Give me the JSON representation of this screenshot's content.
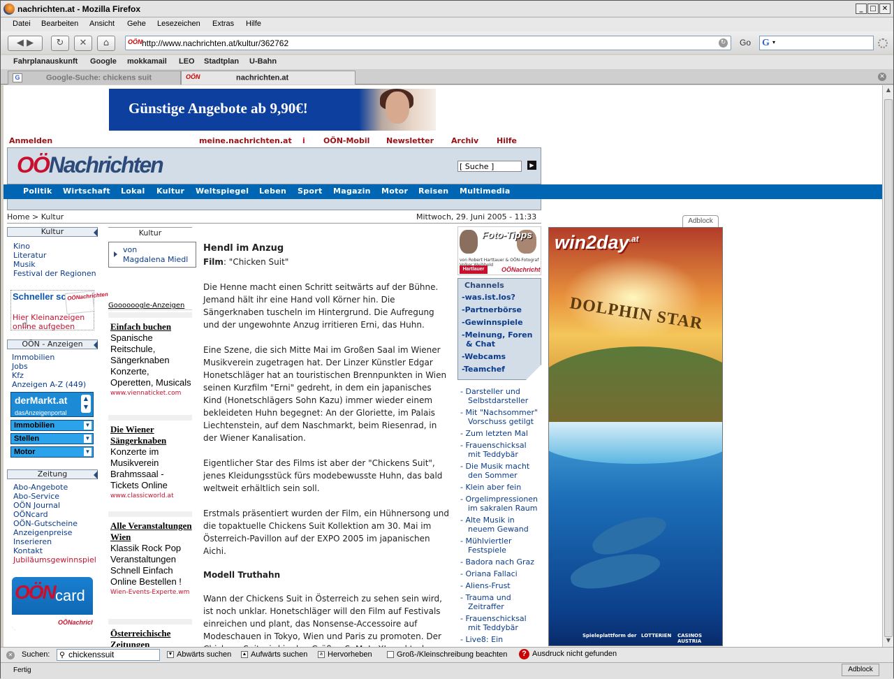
{
  "window": {
    "title": "nachrichten.at - Mozilla Firefox"
  },
  "menu": [
    "Datei",
    "Bearbeiten",
    "Ansicht",
    "Gehe",
    "Lesezeichen",
    "Extras",
    "Hilfe"
  ],
  "nav": {
    "url": "http://www.nachrichten.at/kultur/362762",
    "go_label": "Go"
  },
  "bookmarks": [
    "Fahrplanauskunft",
    "Google",
    "mokkamail",
    "LEO",
    "Stadtplan",
    "U-Bahn"
  ],
  "tabs": [
    {
      "label": "Google-Suche: chickens suit"
    },
    {
      "label": "nachrichten.at"
    }
  ],
  "page": {
    "banner": "Günstige Angebote ab 9,90€!",
    "toplinks": [
      "Anmelden",
      "meine.nachrichten.at",
      "OÖN-Mobil",
      "Newsletter",
      "Archiv",
      "Hilfe"
    ],
    "logo_a": "OÖ",
    "logo_b": "Nachrichten",
    "search_value": "[ Suche ]",
    "nav": [
      "Politik",
      "Wirtschaft",
      "Lokal",
      "Kultur",
      "Weltspiegel",
      "Leben",
      "Sport",
      "Magazin",
      "Motor",
      "Reisen",
      "Multimedia"
    ],
    "breadcrumb": "Home > Kultur",
    "date": "Mittwoch, 29. Juni 2005 - 11:33",
    "left": {
      "kultur_head": "Kultur",
      "kultur_links": [
        "Kino",
        "Literatur",
        "Musik",
        "Festival der Regionen"
      ],
      "promo_title": "Schneller schalten",
      "promo_paper": "OÖNachrichten",
      "promo_l1": "Hier Kleinanzeigen",
      "promo_l2": "online aufgeben",
      "anzeigen_head": "OÖN - Anzeigen",
      "anzeigen_links": [
        "Immobilien",
        "Jobs",
        "Kfz",
        "Anzeigen A-Z (449)"
      ],
      "dermarkt": "derMarkt.at",
      "dermarkt_sub": "dasAnzeigenportal",
      "selects": [
        "Immobilien",
        "Stellen",
        "Motor"
      ],
      "zeitung_head": "Zeitung",
      "zeitung_links": [
        "Abo-Angebote",
        "Abo-Service",
        "OÖN Journal",
        "OÖNcard",
        "OÖN-Gutscheine",
        "Anzeigenpreise",
        "Inserieren",
        "Kontakt"
      ],
      "jubi": "Jubiläumsgewinnspiel",
      "card_oon": "OÖN",
      "card_word": "card",
      "card_logo": "OÖNachrichten"
    },
    "mid": {
      "head": "Kultur",
      "von": "von",
      "author": "Magdalena Miedl",
      "google_label": "Goooooogle-Anzeigen",
      "ads": [
        {
          "title": "Einfach buchen",
          "body": "Spanische Reitschule, Sängerknaben Konzerte, Operetten, Musicals",
          "url": "www.viennaticket.com"
        },
        {
          "title": "Die Wiener Sängerknaben",
          "body": "Konzerte im Musikverein Brahmssaal - Tickets Online",
          "url": "www.classicworld.at"
        },
        {
          "title": "Alle Veranstaltungen Wien",
          "body": "Klassik Rock Pop Veranstaltungen Schnell Einfach Online Bestellen !",
          "url": "Wien-Events-Experte.wm"
        },
        {
          "title": "Österreichische Zeitungen",
          "body": "",
          "url": ""
        }
      ]
    },
    "article": {
      "title": "Hendl im Anzug",
      "film_label": "Film",
      "film_value": ": \"Chicken Suit\"",
      "p1": "Die Henne macht einen Schritt seitwärts auf der Bühne. Jemand hält ihr eine Hand voll Körner hin. Die Sängerknaben tuscheln im Hintergrund. Die Aufregung und der ungewohnte Anzug irritieren Erni, das Huhn.",
      "p2": "Eine Szene, die sich Mitte Mai im Großen Saal im Wiener Musikverein zugetragen hat. Der Linzer Künstler Edgar Honetschläger hat an touristischen Brennpunkten in Wien seinen Kurzfilm \"Erni\" gedreht, in dem ein japanisches Kind (Honetschlägers Sohn Kazu) immer wieder einem bekleideten Huhn begegnet: An der Gloriette, im Palais Liechtenstein, auf dem Naschmarkt, beim Riesenrad, in der Wiener Kanalisation.",
      "p3": "Eigentlicher Star des Films ist aber der \"Chickens Suit\", jenes Kleidungsstück fürs modebewusste Huhn, das bald weltweit erhältlich sein soll.",
      "p4": "Erstmals präsentiert wurden der Film, ein Hühnersong und die topaktuelle Chickens Suit Kollektion am 30. Mai im Österreich-Pavillon auf der EXPO 2005 im japanischen Aichi.",
      "sub": "Modell Truthahn",
      "p5": "Wann der Chickens Suit in Österreich zu sehen sein wird, ist noch unklar. Honetschläger will den Film auf Festivals einreichen und plant, das Nonsense-Accessoire auf Modeschauen in Tokyo, Wien und Paris zu promoten. Der Chickens Suit wird in den Größen S, M, L, XL und turkey (für"
    },
    "right": {
      "foto_title": "Foto-Tipps",
      "foto_small": "von Robert Harttauer & OÖN-Fotograf Volker Weihbold",
      "foto_hartlauer": "Hartlauer",
      "foto_oon": "OÖNachrichten",
      "channels_title": "Channels",
      "channels": [
        "-was.ist.los?",
        "-Partnerbörse",
        "-Gewinnspiele",
        "-Meinung, Foren",
        "& Chat",
        "-Webcams",
        "-Teamchef"
      ],
      "related": [
        [
          "Darsteller und",
          "Selbstdarsteller"
        ],
        [
          "Mit \"Nachsommer\"",
          "Vorschuss getilgt"
        ],
        [
          "Zum letzten Mal"
        ],
        [
          "Frauenschicksal",
          "mit Teddybär"
        ],
        [
          "Die Musik macht",
          "den Sommer"
        ],
        [
          "Klein aber fein"
        ],
        [
          "Orgelimpressionen",
          "im sakralen Raum"
        ],
        [
          "Alte Musik in",
          "neuem Gewand"
        ],
        [
          "Mühlviertler",
          "Festspiele"
        ],
        [
          "Badora nach Graz"
        ],
        [
          "Oriana Fallaci"
        ],
        [
          "Aliens-Frust"
        ],
        [
          "Trauma und",
          "Zeitraffer"
        ],
        [
          "Frauenschicksal",
          "mit Teddybär"
        ],
        [
          "Live8: Ein",
          ""
        ]
      ]
    },
    "ad": {
      "adblock": "Adblock",
      "brand": "win2day",
      "brand_tld": ".at",
      "game": "DOLPHIN STAR",
      "footer_a": "Spieleplattform der",
      "footer_b": "LOTTERIEN",
      "footer_c": "CASINOS AUSTRIA"
    }
  },
  "find": {
    "label": "Suchen:",
    "value": "chickenssuit",
    "down": "Abwärts suchen",
    "up": "Aufwärts suchen",
    "highlight": "Hervorheben",
    "case": "Groß-/Kleinschreibung beachten",
    "notfound": "Ausdruck nicht gefunden"
  },
  "status": {
    "text": "Fertig",
    "adblock": "Adblock"
  }
}
